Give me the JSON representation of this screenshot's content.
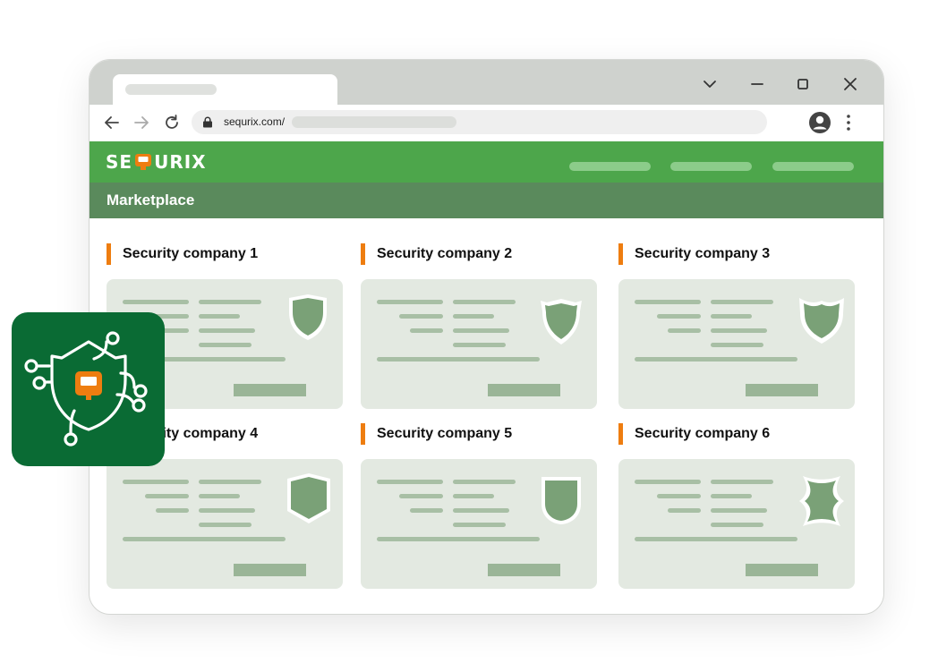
{
  "browser": {
    "address_bar": {
      "url": "sequrix.com/"
    },
    "controls": {
      "back": "back-arrow-icon",
      "forward": "forward-arrow-icon",
      "reload": "reload-icon",
      "minimize": "minimize-icon",
      "maximize": "maximize-icon",
      "close": "close-icon",
      "tab_dropdown": "chevron-down-icon"
    }
  },
  "site": {
    "logo": {
      "text_left": "SE",
      "text_right": "URIX"
    },
    "section_title": "Marketplace",
    "companies": [
      {
        "name": "Security company 1",
        "badge": "shield-icon"
      },
      {
        "name": "Security company 2",
        "badge": "shield-icon"
      },
      {
        "name": "Security company 3",
        "badge": "shield-icon"
      },
      {
        "name": "Security company 4",
        "badge": "shield-icon"
      },
      {
        "name": "Security company 5",
        "badge": "shield-icon"
      },
      {
        "name": "Security company 6",
        "badge": "shield-icon"
      }
    ]
  },
  "colors": {
    "header_green": "#4da64b",
    "subbar_green": "#5a8a5c",
    "accent_orange": "#ee7d10",
    "card_bg": "#e3e9e1",
    "app_icon_bg": "#0a6b34"
  }
}
